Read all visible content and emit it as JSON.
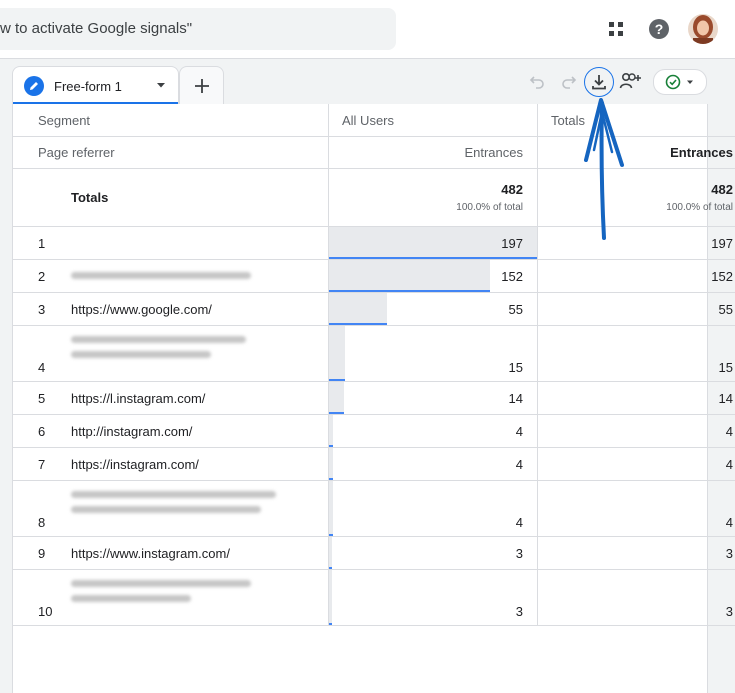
{
  "search": {
    "text": "w to activate Google signals\""
  },
  "tab": {
    "label": "Free-form 1"
  },
  "table": {
    "segment_header": "Segment",
    "dimension_header": "Page referrer",
    "col2_header": "All Users",
    "col3_header": "Totals",
    "metric2_label": "Entrances",
    "metric3_label": "Entrances",
    "totals_label": "Totals",
    "totals_value2": "482",
    "totals_pct2": "100.0% of total",
    "totals_value3": "482",
    "totals_pct3": "100.0% of total",
    "rows": [
      {
        "index": "1",
        "referrer": "",
        "all_users": "197",
        "totals": "197",
        "share": 1.0
      },
      {
        "index": "2",
        "referrer": "",
        "all_users": "152",
        "totals": "152",
        "share": 0.772
      },
      {
        "index": "3",
        "referrer": "https://www.google.com/",
        "all_users": "55",
        "totals": "55",
        "share": 0.279
      },
      {
        "index": "4",
        "referrer": "",
        "all_users": "15",
        "totals": "15",
        "share": 0.076
      },
      {
        "index": "5",
        "referrer": "https://l.instagram.com/",
        "all_users": "14",
        "totals": "14",
        "share": 0.071
      },
      {
        "index": "6",
        "referrer": "http://instagram.com/",
        "all_users": "4",
        "totals": "4",
        "share": 0.02
      },
      {
        "index": "7",
        "referrer": "https://instagram.com/",
        "all_users": "4",
        "totals": "4",
        "share": 0.02
      },
      {
        "index": "8",
        "referrer": "",
        "all_users": "4",
        "totals": "4",
        "share": 0.02
      },
      {
        "index": "9",
        "referrer": "https://www.instagram.com/",
        "all_users": "3",
        "totals": "3",
        "share": 0.015
      },
      {
        "index": "10",
        "referrer": "",
        "all_users": "3",
        "totals": "3",
        "share": 0.015
      }
    ]
  },
  "colors": {
    "accent": "#1a73e8",
    "bar_fill": "#e8eaed",
    "bar_line": "#4285f4",
    "annotation": "#1565c0"
  }
}
